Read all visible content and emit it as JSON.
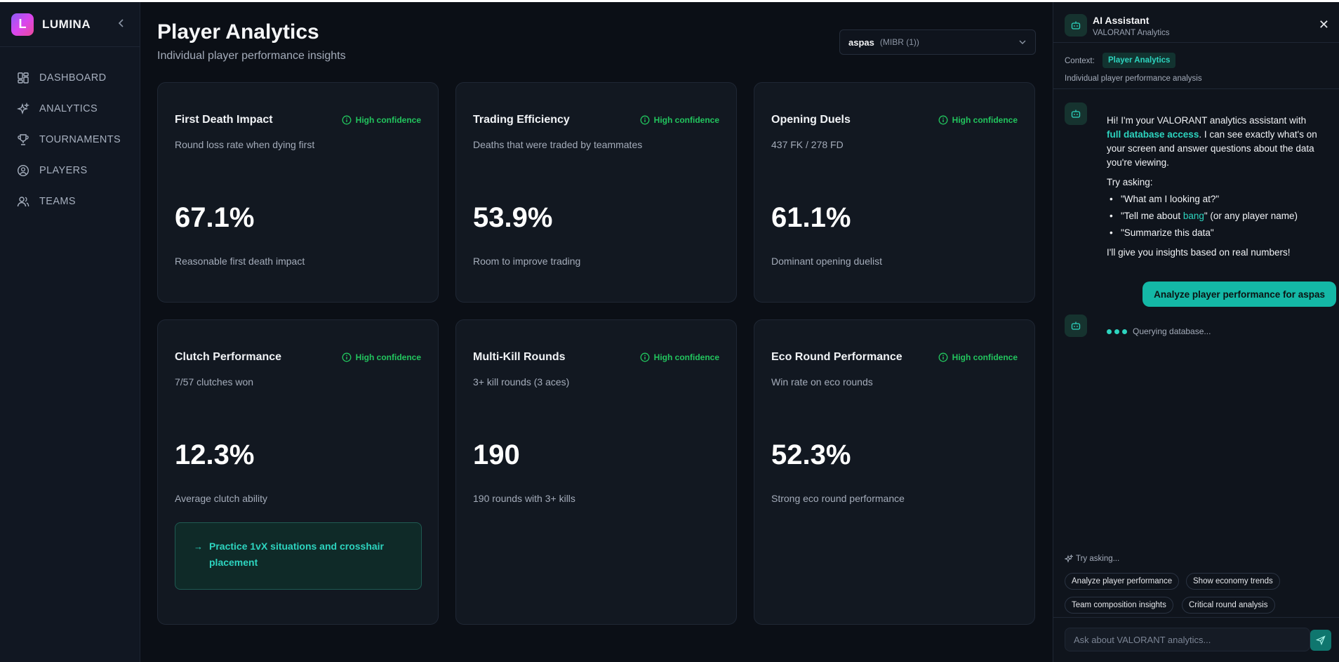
{
  "brand": {
    "logo_letter": "L",
    "name": "LUMINA"
  },
  "nav": [
    {
      "label": "DASHBOARD",
      "icon": "dashboard-icon"
    },
    {
      "label": "ANALYTICS",
      "icon": "sparkles-icon"
    },
    {
      "label": "TOURNAMENTS",
      "icon": "trophy-icon"
    },
    {
      "label": "PLAYERS",
      "icon": "user-circle-icon"
    },
    {
      "label": "TEAMS",
      "icon": "users-icon"
    }
  ],
  "page": {
    "title": "Player Analytics",
    "subtitle": "Individual player performance insights"
  },
  "player_select": {
    "name": "aspas",
    "team": "(MIBR (1))"
  },
  "cards": [
    {
      "title": "First Death Impact",
      "confidence": "High confidence",
      "desc": "Round loss rate when dying first",
      "value": "67.1%",
      "note": "Reasonable first death impact"
    },
    {
      "title": "Trading Efficiency",
      "confidence": "High confidence",
      "desc": "Deaths that were traded by teammates",
      "value": "53.9%",
      "note": "Room to improve trading"
    },
    {
      "title": "Opening Duels",
      "confidence": "High confidence",
      "desc": "437 FK / 278 FD",
      "value": "61.1%",
      "note": "Dominant opening duelist"
    },
    {
      "title": "Clutch Performance",
      "confidence": "High confidence",
      "desc": "7/57 clutches won",
      "value": "12.3%",
      "note": "Average clutch ability",
      "tip": "Practice 1vX situations and crosshair placement"
    },
    {
      "title": "Multi-Kill Rounds",
      "confidence": "High confidence",
      "desc": "3+ kill rounds (3 aces)",
      "value": "190",
      "note": "190 rounds with 3+ kills"
    },
    {
      "title": "Eco Round Performance",
      "confidence": "High confidence",
      "desc": "Win rate on eco rounds",
      "value": "52.3%",
      "note": "Strong eco round performance"
    }
  ],
  "ai": {
    "title": "AI Assistant",
    "subtitle": "VALORANT Analytics",
    "close": "✕",
    "context_label": "Context:",
    "context_pill": "Player Analytics",
    "context_desc": "Individual player performance analysis",
    "greeting_1": "Hi! I'm your VALORANT analytics assistant with ",
    "greeting_hl": "full database access",
    "greeting_2": ". I can see exactly what's on your screen and answer questions about the data you're viewing.",
    "try_asking": "Try asking:",
    "suggestion_1": "\"What am I looking at?\"",
    "suggestion_2_pre": "\"Tell me about ",
    "suggestion_2_hl": "bang",
    "suggestion_2_post": "\" (or any player name)",
    "suggestion_3": "\"Summarize this data\"",
    "closing": "I'll give you insights based on real numbers!",
    "user_message": "Analyze player performance for aspas",
    "typing_text": "Querying database...",
    "try_label": "Try asking...",
    "chips": [
      "Analyze player performance",
      "Show economy trends",
      "Team composition insights",
      "Critical round analysis"
    ],
    "input_placeholder": "Ask about VALORANT analytics..."
  },
  "colors": {
    "accent": "#2dd4bf",
    "confidence": "#22c55e",
    "bubble": "#14b8a6"
  }
}
